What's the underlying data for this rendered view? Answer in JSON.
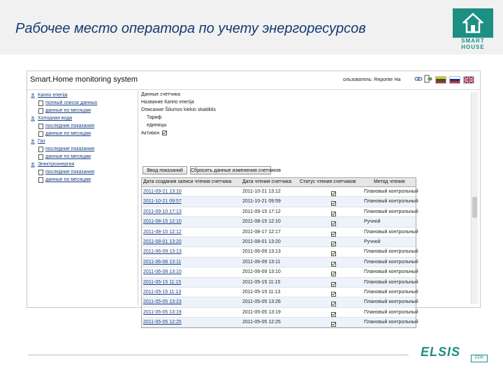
{
  "slide": {
    "title": "Рабочее место оператора по учету энергоресурсов",
    "logo_text_line1": "SMART",
    "logo_text_line2": "HOUSE",
    "footer_logo": "ELSIS",
    "footer_logo_sub": "EPR"
  },
  "app": {
    "title": "Smart.Home monitoring system",
    "user_label": "ользователь: Reporter На"
  },
  "sidebar": {
    "nodes": [
      {
        "label": "Каппо епегіја",
        "children": [
          "полный список данных",
          "данные по месяцам"
        ]
      },
      {
        "label": "Холодная вода",
        "children": [
          "последние показания",
          "данные по месяцам"
        ]
      },
      {
        "label": "Газ",
        "children": [
          "последние показания",
          "данные по месяцам"
        ]
      },
      {
        "label": "Электроэнергия",
        "children": [
          "последние показания",
          "данные по месяцам"
        ]
      }
    ]
  },
  "content": {
    "section_title": "Данные счетчика",
    "info": {
      "name": "Название Каппо епегіја",
      "desc": "Описание Šilumos kiekio skaitiklis",
      "tariff_label": "Тариф",
      "tariff_value": "Тариф",
      "unit_label": "единицы",
      "active_label": "Активен"
    },
    "buttons": {
      "enter_reading": "Ввод показаний",
      "reset_data": "Сбросить данные изменения счетчиков"
    },
    "grid": {
      "columns": [
        "Дата создания записи чтения счетчика",
        "Дата чтения счетчика",
        "Статус чтения счетчиков",
        "Метод чтения"
      ],
      "rows": [
        {
          "created": "2011-09-21 13:10",
          "read": "2011-10-21 13:12",
          "status": true,
          "method": "Плановый контрольный"
        },
        {
          "created": "2011-10-21 09:57",
          "read": "2011-10-21 09:59",
          "status": true,
          "method": "Плановый контрольный"
        },
        {
          "created": "2011-09-10 17:13",
          "read": "2011-09-15 17:12",
          "status": true,
          "method": "Плановый контрольный"
        },
        {
          "created": "2011-08-15 12:10",
          "read": "2011-08-15 12:10",
          "status": true,
          "method": "Ручной"
        },
        {
          "created": "2011-08-15 12:12",
          "read": "2011-08-17 12:17",
          "status": true,
          "method": "Плановый контрольный"
        },
        {
          "created": "2011-08-01 13:20",
          "read": "2011-08-01 13:20",
          "status": true,
          "method": "Ручной"
        },
        {
          "created": "2011-06-09 13:13",
          "read": "2011-06-09 13:13",
          "status": true,
          "method": "Плановый контрольный"
        },
        {
          "created": "2011-06-08 13:11",
          "read": "2011-06-09 13:11",
          "status": true,
          "method": "Плановый контрольный"
        },
        {
          "created": "2011-06-08 13:10",
          "read": "2011-06-09 13:10",
          "status": true,
          "method": "Плановый контрольный"
        },
        {
          "created": "2011-05-15 11:15",
          "read": "2011-05-15 11:15",
          "status": true,
          "method": "Плановый контрольный"
        },
        {
          "created": "2011-05-15 11:13",
          "read": "2011-05-15 11:13",
          "status": true,
          "method": "Плановый контрольный"
        },
        {
          "created": "2011-05-05 13:23",
          "read": "2011-05-05 13:26",
          "status": true,
          "method": "Плановый контрольный"
        },
        {
          "created": "2011-05-05 13:19",
          "read": "2011-05-05 13:19",
          "status": true,
          "method": "Плановый контрольный"
        },
        {
          "created": "2011-05-05 12:25",
          "read": "2011-05-05 12:25",
          "status": true,
          "method": "Плановый контрольный"
        }
      ]
    }
  },
  "colors": {
    "brand": "#1e8f83",
    "title": "#123a73",
    "link": "#1a3f86",
    "row_alt": "#eef3fb"
  },
  "icons": [
    "user-icon",
    "link-icon",
    "logout-icon",
    "flag-lt-icon",
    "flag-ru-icon",
    "flag-gb-icon",
    "checkbox-icon",
    "house-logo-icon"
  ]
}
